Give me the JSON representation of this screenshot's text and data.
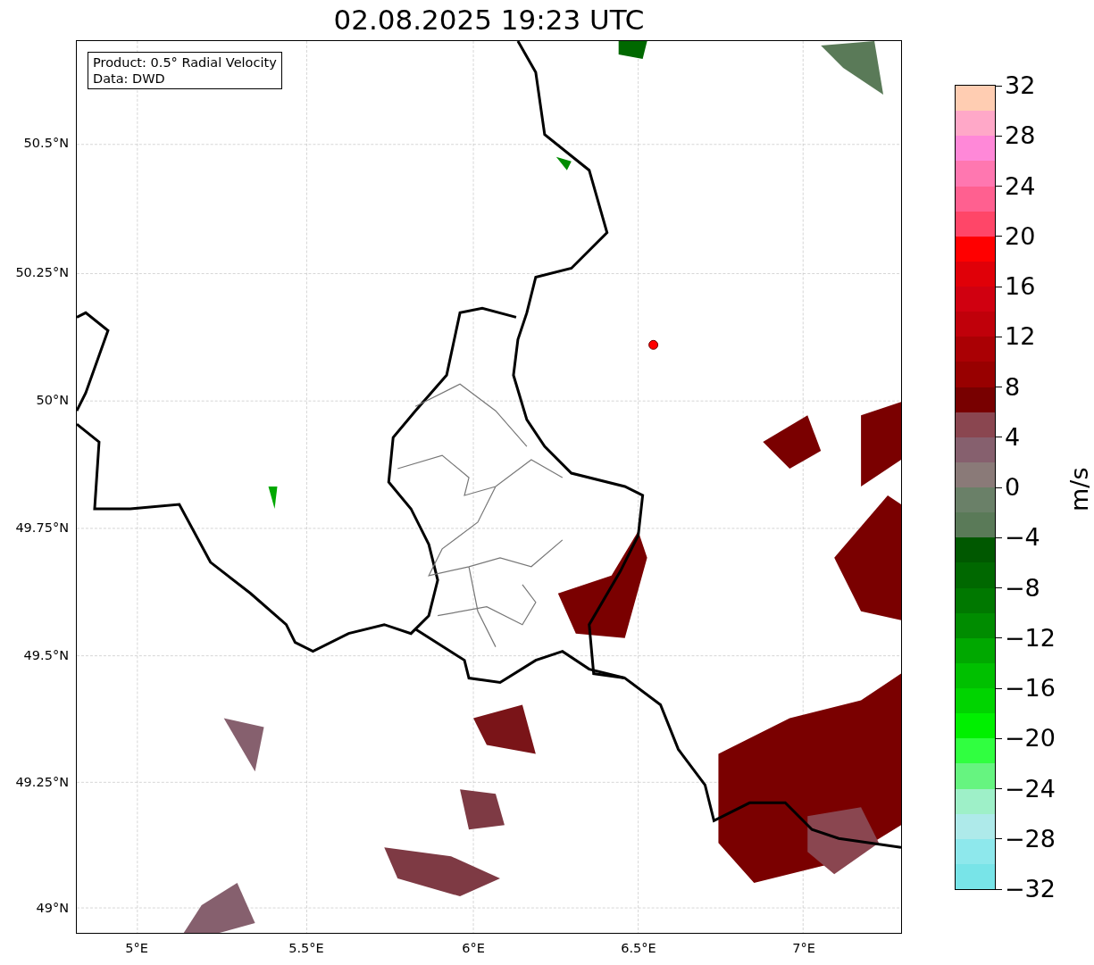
{
  "title": "02.08.2025 19:23 UTC",
  "info": [
    "Product: 0.5° Radial Velocity",
    "Data: DWD"
  ],
  "axes": {
    "xticks": [
      "5°E",
      "5.5°E",
      "6°E",
      "6.5°E",
      "7°E"
    ],
    "yticks": [
      "50.5°N",
      "50.25°N",
      "50°N",
      "49.75°N",
      "49.5°N",
      "49.25°N",
      "49°N"
    ]
  },
  "colorbar": {
    "label": "m/s",
    "ticks": [
      "32",
      "28",
      "24",
      "20",
      "16",
      "12",
      "8",
      "4",
      "0",
      "−4",
      "−8",
      "−12",
      "−16",
      "−20",
      "−24",
      "−28",
      "−32"
    ],
    "segments": [
      {
        "color": "#ffcdb2"
      },
      {
        "color": "#ffa8c8"
      },
      {
        "color": "#ff88d8"
      },
      {
        "color": "#ff77b0"
      },
      {
        "color": "#ff6090"
      },
      {
        "color": "#ff4668"
      },
      {
        "color": "#ff0000"
      },
      {
        "color": "#e00008"
      },
      {
        "color": "#d00010"
      },
      {
        "color": "#c0000a"
      },
      {
        "color": "#aa0004"
      },
      {
        "color": "#980000"
      },
      {
        "color": "#780000"
      },
      {
        "color": "#8a4650"
      },
      {
        "color": "#86606e"
      },
      {
        "color": "#8a7a78"
      },
      {
        "color": "#6a8068"
      },
      {
        "color": "#5a7a58"
      },
      {
        "color": "#005800"
      },
      {
        "color": "#006800"
      },
      {
        "color": "#007800"
      },
      {
        "color": "#008c00"
      },
      {
        "color": "#00a800"
      },
      {
        "color": "#00c000"
      },
      {
        "color": "#00d400"
      },
      {
        "color": "#00f000"
      },
      {
        "color": "#30ff40"
      },
      {
        "color": "#66f480"
      },
      {
        "color": "#9ef0c8"
      },
      {
        "color": "#aeeaea"
      },
      {
        "color": "#8ee8ec"
      },
      {
        "color": "#78e4e8"
      }
    ]
  }
}
